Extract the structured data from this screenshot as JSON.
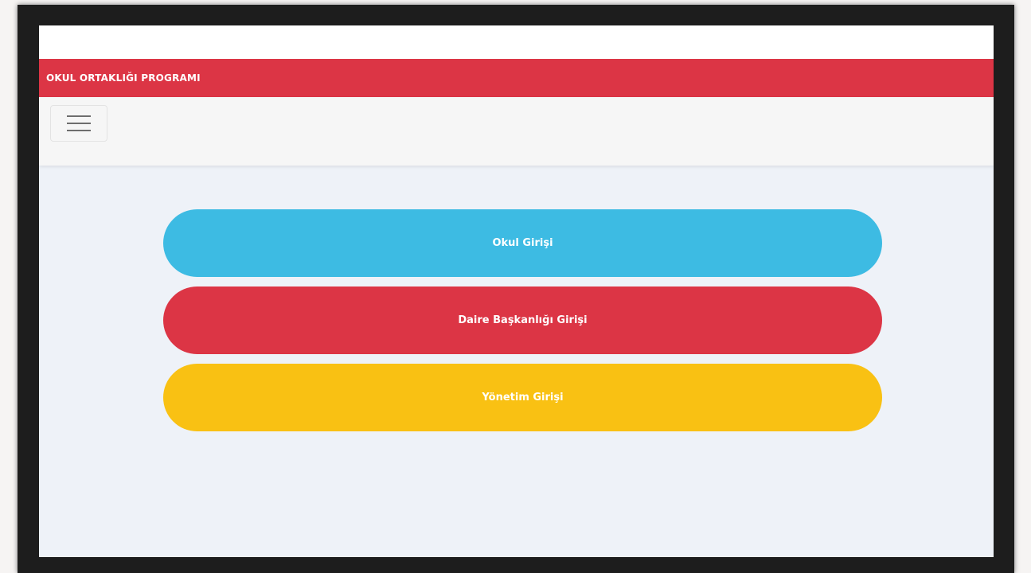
{
  "header": {
    "brand_title": "OKUL ORTAKLIĞI PROGRAMI"
  },
  "navbar": {
    "toggle_icon": "hamburger-icon"
  },
  "login_buttons": [
    {
      "label": "Okul Girişi",
      "color": "#3dbbe3"
    },
    {
      "label": "Daire Başkanlığı Girişi",
      "color": "#dc3545"
    },
    {
      "label": "Yönetim Girişi",
      "color": "#f9c113"
    }
  ],
  "colors": {
    "brand": "#dc3545",
    "background": "#eef2f8",
    "navbar": "#f6f6f6"
  }
}
